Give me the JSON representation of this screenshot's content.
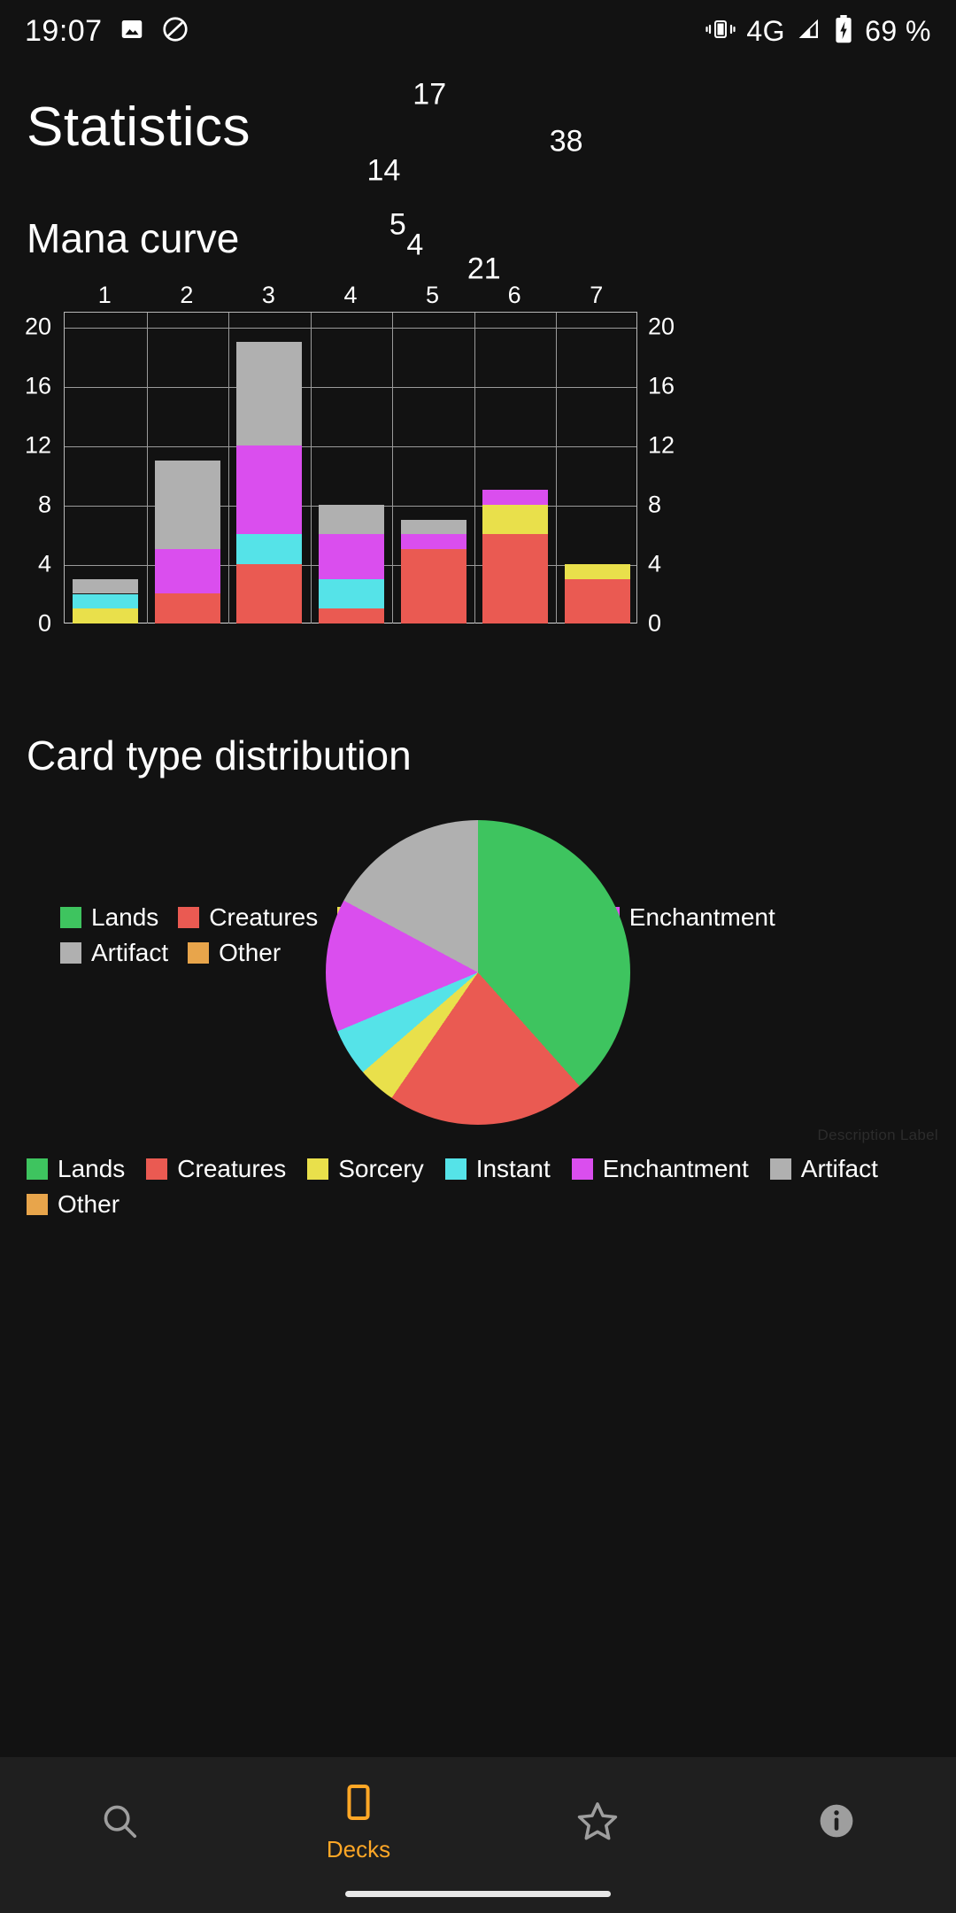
{
  "status_bar": {
    "time": "19:07",
    "icons_left": [
      "image-icon",
      "do-not-disturb-icon"
    ],
    "icons_right": [
      "vibrate-icon",
      "signal-icon",
      "battery-charging-icon"
    ],
    "network": "4G",
    "battery": "69 %"
  },
  "header": {
    "title": "Statistics"
  },
  "sections": {
    "mana_curve_title": "Mana curve",
    "card_type_title": "Card type distribution"
  },
  "colors": {
    "lands": "#3ec45f",
    "creatures": "#ea5a52",
    "sorcery": "#e9e04b",
    "instant": "#55e3e8",
    "enchantment": "#da4eee",
    "artifact": "#b0b0b0",
    "other": "#e8a54b",
    "background": "#121212",
    "nav_background": "#1f1f1f",
    "accent": "#ffa726",
    "grid": "#9a9a9a",
    "text": "#ffffff"
  },
  "chart_data": [
    {
      "type": "bar",
      "title": "Mana curve",
      "stacked": true,
      "xlabel": "",
      "ylabel": "",
      "categories": [
        "1",
        "2",
        "3",
        "4",
        "5",
        "6",
        "7"
      ],
      "ylim": [
        0,
        21
      ],
      "yticks": [
        0,
        4,
        8,
        12,
        16,
        20
      ],
      "ytick_labels_left": [
        "0",
        "4",
        "8",
        "12",
        "16",
        "20"
      ],
      "ytick_labels_right": [
        "0",
        "4",
        "8",
        "12",
        "16",
        "20"
      ],
      "grid": true,
      "legend_position": "below",
      "series": [
        {
          "name": "Lands",
          "color": "#3ec45f",
          "values": [
            0,
            0,
            0,
            0,
            0,
            0,
            0
          ]
        },
        {
          "name": "Creatures",
          "color": "#ea5a52",
          "values": [
            0,
            2,
            4,
            1,
            5,
            6,
            3
          ]
        },
        {
          "name": "Sorcery",
          "color": "#e9e04b",
          "values": [
            1,
            0,
            0,
            0,
            0,
            2,
            1
          ]
        },
        {
          "name": "Instant",
          "color": "#55e3e8",
          "values": [
            1,
            0,
            2,
            2,
            0,
            0,
            0
          ]
        },
        {
          "name": "Enchantment",
          "color": "#da4eee",
          "values": [
            0,
            3,
            6,
            3,
            1,
            1,
            0
          ]
        },
        {
          "name": "Artifact",
          "color": "#b0b0b0",
          "values": [
            1,
            6,
            7,
            2,
            1,
            0,
            0
          ]
        },
        {
          "name": "Other",
          "color": "#e8a54b",
          "values": [
            0,
            0,
            0,
            0,
            0,
            0,
            0
          ]
        }
      ],
      "totals": [
        3,
        11,
        19,
        8,
        7,
        9,
        4
      ],
      "legend": [
        "Lands",
        "Creatures",
        "Sorcery",
        "Instant",
        "Enchantment",
        "Artifact",
        "Other"
      ]
    },
    {
      "type": "pie",
      "title": "Card type distribution",
      "labels": [
        "Lands",
        "Creatures",
        "Sorcery",
        "Instant",
        "Enchantment",
        "Artifact",
        "Other"
      ],
      "values": [
        38,
        21,
        4,
        5,
        14,
        17,
        0
      ],
      "colors": [
        "#3ec45f",
        "#ea5a52",
        "#e9e04b",
        "#55e3e8",
        "#da4eee",
        "#b0b0b0",
        "#e8a54b"
      ],
      "data_labels": [
        "38",
        "21",
        "4",
        "5",
        "14",
        "17"
      ],
      "description_label": "Description Label",
      "legend_position": "below",
      "legend": [
        "Lands",
        "Creatures",
        "Sorcery",
        "Instant",
        "Enchantment",
        "Artifact",
        "Other"
      ]
    }
  ],
  "bottom_nav": {
    "items": [
      {
        "icon": "search-icon",
        "label": "",
        "selected": false
      },
      {
        "icon": "decks-icon",
        "label": "Decks",
        "selected": true
      },
      {
        "icon": "star-icon",
        "label": "",
        "selected": false
      },
      {
        "icon": "info-icon",
        "label": "",
        "selected": false
      }
    ]
  }
}
